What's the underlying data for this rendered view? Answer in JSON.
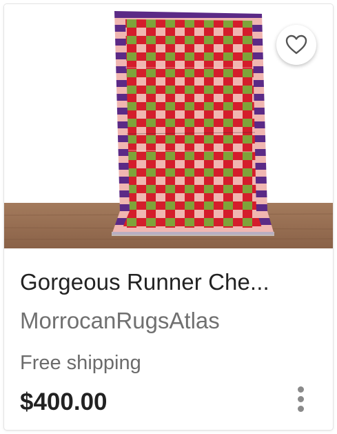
{
  "listing": {
    "title": "Gorgeous Runner Che...",
    "shop_name": "MorrocanRugsAtlas",
    "shipping": "Free shipping",
    "price": "$400.00",
    "favorite_icon": "heart-outline-icon",
    "more_icon": "vertical-dots-icon"
  },
  "colors": {
    "rug_red": "#d41d2b",
    "rug_green": "#7fa33a",
    "rug_pink": "#f0b6b1",
    "rug_purple": "#5b2a86",
    "floor": "#9b7154",
    "wall": "#ffffff"
  }
}
